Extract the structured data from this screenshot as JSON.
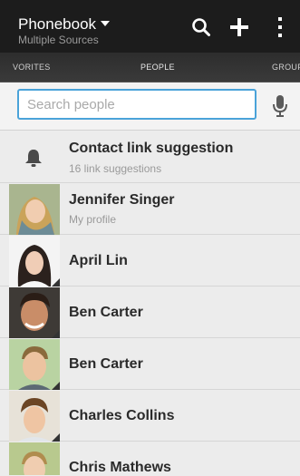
{
  "header": {
    "title": "Phonebook",
    "subtitle": "Multiple Sources",
    "actions": [
      "search-icon",
      "plus-icon",
      "overflow-menu-icon"
    ]
  },
  "tabs": {
    "left": "VORITES",
    "center": "PEOPLE",
    "right": "GROUP"
  },
  "search": {
    "placeholder": "Search people",
    "value": ""
  },
  "suggestion": {
    "title": "Contact link suggestion",
    "subtitle": "16 link suggestions"
  },
  "contacts": [
    {
      "name": "Jennifer Singer",
      "subtitle": "My profile"
    },
    {
      "name": "April Lin"
    },
    {
      "name": "Ben Carter"
    },
    {
      "name": "Ben Carter"
    },
    {
      "name": "Charles Collins"
    },
    {
      "name": "Chris Mathews"
    }
  ],
  "colors": {
    "header_bg": "#1c1c1c",
    "search_border": "#4aa3d9",
    "list_bg": "#ececec"
  }
}
